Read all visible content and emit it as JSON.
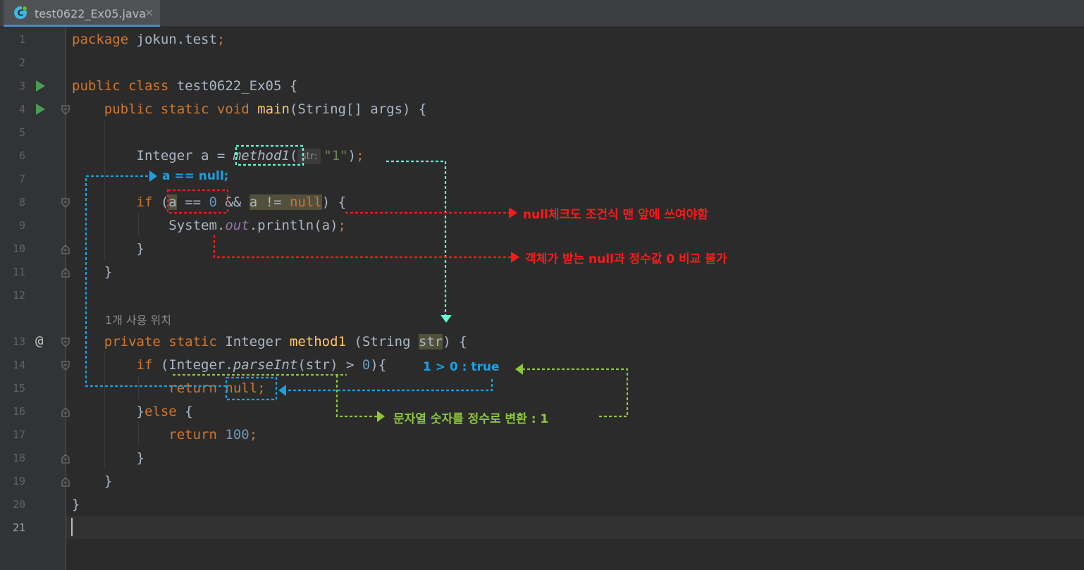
{
  "tab": {
    "title": "test0622_Ex05.java",
    "close": "×"
  },
  "editor": {
    "line_numbers": [
      "1",
      "2",
      "3",
      "4",
      "5",
      "6",
      "7",
      "8",
      "9",
      "10",
      "11",
      "12",
      "13",
      "14",
      "15",
      "16",
      "17",
      "18",
      "19",
      "20",
      "21"
    ],
    "current_line": "21",
    "gutter_marker": "@",
    "usage_hint": "1개 사용 위치",
    "param_hint": "str:",
    "code": {
      "l1_kw": "package",
      "l1_rest": " jokun.test",
      "l3_kw": "public class",
      "l3_rest": " test0622_Ex05 {",
      "l4_kw": "public static void",
      "l4_fn": "main",
      "l4_rest": "(String[] args) {",
      "l6_a": "Integer a = ",
      "l6_call": "method1",
      "l6_str": "\"1\"",
      "l8_if": "if",
      "l8_var": "a",
      "l8_eq": " == ",
      "l8_zero": "0",
      "l8_and": " && ",
      "l8_var2": "a",
      "l8_ne": " != ",
      "l8_null": "null",
      "l8_end": ") {",
      "l9_sys": "System.",
      "l9_out": "out",
      "l9_rest": ".println(a)",
      "close_brace": "}",
      "l13_kw1": "private static",
      "l13_type": " Integer ",
      "l13_fn": "method1",
      "l13_args": " (String ",
      "l13_param": "str",
      "l13_end": ") {",
      "l14_if": "if",
      "l14_a": " (Integer.",
      "l14_parse": "parseInt",
      "l14_b": "(str) > ",
      "l14_zero": "0",
      "l14_c": "){",
      "l15_ret": "return",
      "l15_null": "null",
      "l16_a": "}",
      "l16_else": "else",
      "l16_b": " {",
      "l17_ret": "return",
      "l17_num": "100",
      "semicolon": ";"
    }
  },
  "annotations": {
    "a_null": "a == null;",
    "null_check": "null체크도 조건식 맨 앞에 쓰여야함",
    "compare": "객체가 받는 null과 정수값 0 비교 불가",
    "true_note": "1 > 0  : true",
    "convert": "문자열 숫자를 정수로 변환 : 1"
  },
  "colors": {
    "red": "#ff0000",
    "blue": "#1ba1e2",
    "green": "#8dc63f",
    "teal": "#5effd0"
  }
}
